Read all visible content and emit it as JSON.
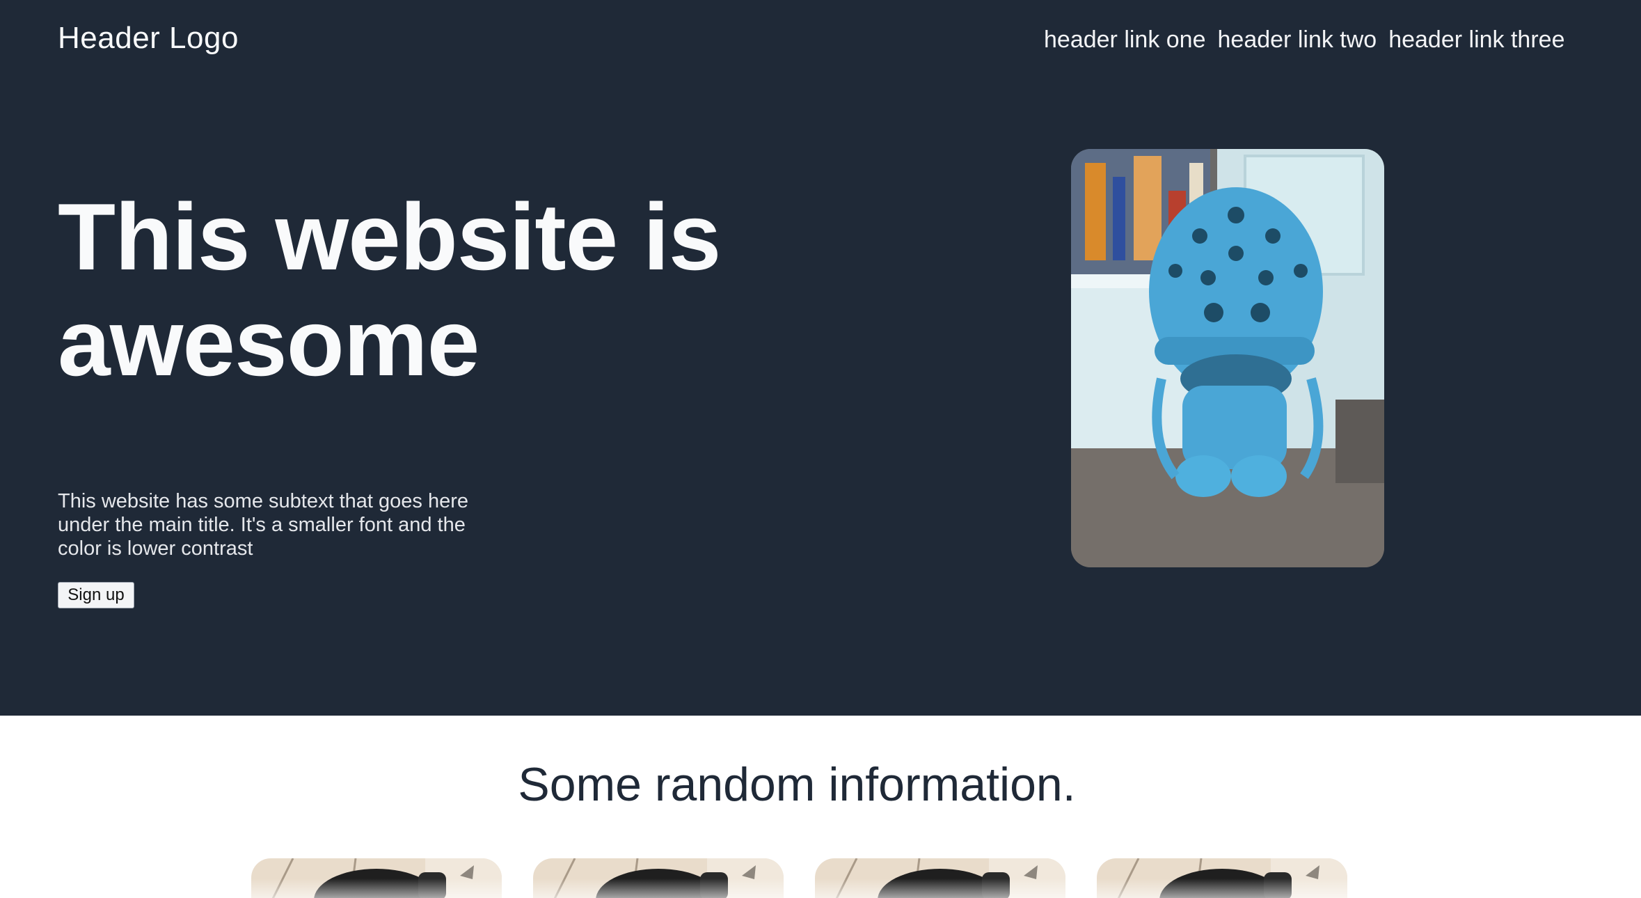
{
  "header": {
    "logo": "Header Logo",
    "links": [
      {
        "label": "header link one"
      },
      {
        "label": "header link two"
      },
      {
        "label": "header link three"
      }
    ]
  },
  "hero": {
    "title": "This website is awesome",
    "subtext": "This website has some subtext that goes here under the main title. It's a smaller font and the color is lower contrast",
    "cta_label": "Sign up",
    "image_icon": "croc-character-photo"
  },
  "info": {
    "title": "Some random information.",
    "cards": [
      {
        "image_icon": "croc-shoe-photo"
      },
      {
        "image_icon": "croc-shoe-photo"
      },
      {
        "image_icon": "croc-shoe-photo"
      },
      {
        "image_icon": "croc-shoe-photo"
      }
    ]
  },
  "colors": {
    "hero_background": "#1f2937",
    "hero_text": "#f9fafb",
    "croc_blue": "#4aa6d6"
  }
}
